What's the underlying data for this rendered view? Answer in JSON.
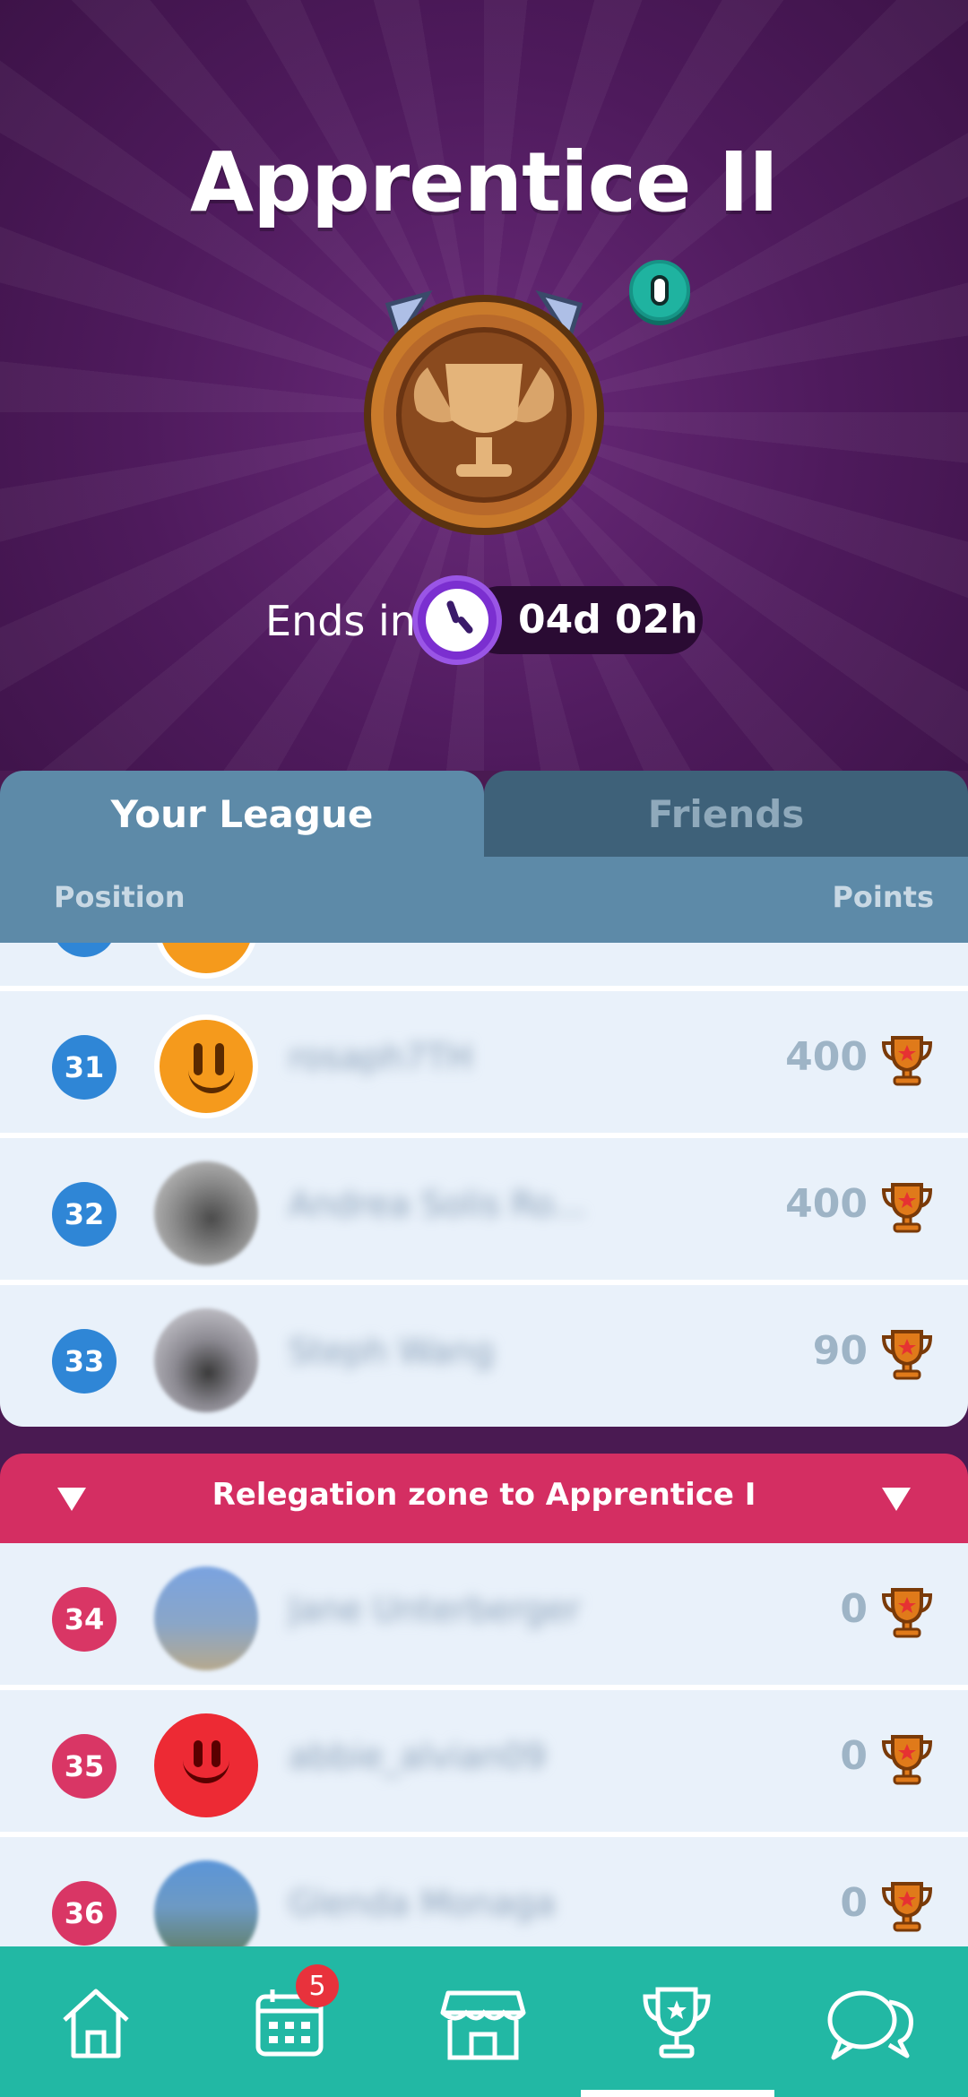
{
  "header": {
    "league_title": "Apprentice II",
    "ends_label": "Ends in",
    "timer": "04d 02h"
  },
  "tabs": [
    {
      "label": "Your League",
      "active": true
    },
    {
      "label": "Friends",
      "active": false
    }
  ],
  "columns": {
    "position": "Position",
    "points": "Points"
  },
  "rows": [
    {
      "rank": "31",
      "name": "rosaph7TH",
      "points": "400",
      "avatar": "orange-smiley"
    },
    {
      "rank": "32",
      "name": "Andrea Solis Ro...",
      "points": "400",
      "avatar": "photo"
    },
    {
      "rank": "33",
      "name": "Steph Wang",
      "points": "90",
      "avatar": "photo"
    }
  ],
  "relegation": {
    "label": "Relegation zone to Apprentice I"
  },
  "relegation_rows": [
    {
      "rank": "34",
      "name": "Jane Unterberger",
      "points": "0",
      "avatar": "photo"
    },
    {
      "rank": "35",
      "name": "abbie_alvian09",
      "points": "0",
      "avatar": "red-smiley"
    },
    {
      "rank": "36",
      "name": "Glenda Monaga",
      "points": "0",
      "avatar": "photo"
    }
  ],
  "nav": {
    "items": [
      "home",
      "calendar",
      "shop",
      "leaderboard",
      "chat"
    ],
    "calendar_badge": "5",
    "active": "leaderboard"
  },
  "colors": {
    "header_bg": "#4e1a5c",
    "tab_active": "#5d8aa8",
    "tab_inactive": "#3e6179",
    "rank_blue": "#2f86d6",
    "rank_red": "#d93665",
    "relegation_bar": "#d42e62",
    "nav_bg": "#22b8a4"
  }
}
